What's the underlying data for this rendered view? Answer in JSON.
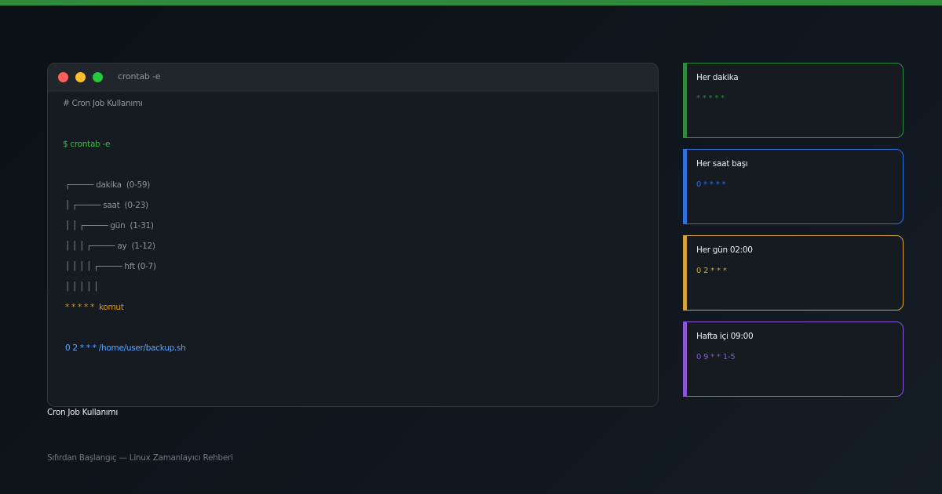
{
  "terminal": {
    "title": "crontab -e",
    "lines": {
      "comment": "# Cron Job Kullanımı",
      "prompt": "$ crontab -e",
      "field_minute": "┌───── dakika  (0-59)",
      "field_hour": "│ ┌───── saat  (0-23)",
      "field_day": "│ │ ┌───── gün  (1-31)",
      "field_month": "│ │ │ ┌───── ay  (1-12)",
      "field_weekday": "│ │ │ │ ┌───── hft (0-7)",
      "field_closing": "│ │ │ │ │",
      "syntax": "* * * * *  komut",
      "example": "0 2 * * * /home/user/backup.sh"
    }
  },
  "caption": "Cron Job Kullanımı",
  "subtitle": "Sıfırdan Başlangıç — Linux Zamanlayıcı Rehberi",
  "cards": [
    {
      "title": "Her dakika",
      "expr": "* * * * *",
      "color": "#2f8a3b"
    },
    {
      "title": "Her saat başı",
      "expr": "0 * * * *",
      "color": "#2f6fde"
    },
    {
      "title": "Her gün 02:00",
      "expr": "0 2 * * *",
      "color": "#d6a03a"
    },
    {
      "title": "Hafta içi 09:00",
      "expr": "0 9 * * 1-5",
      "color": "#8a55d6"
    }
  ],
  "colors": {
    "accent": "#2f8a3b",
    "background": "#0d1117",
    "terminal_bg": "#161b22"
  }
}
